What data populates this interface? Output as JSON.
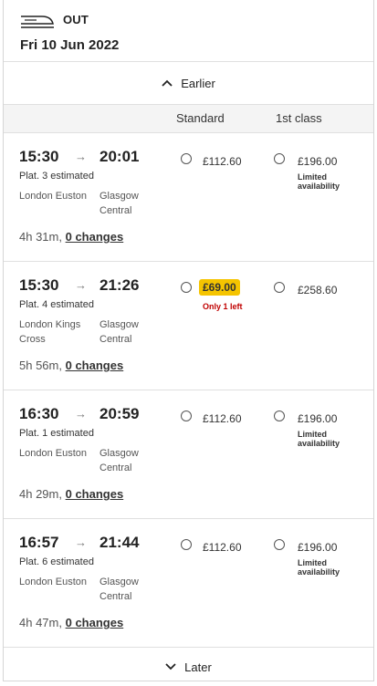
{
  "header": {
    "direction": "OUT",
    "date": "Fri 10 Jun 2022",
    "icon": "train-icon"
  },
  "earlier_label": "Earlier",
  "later_label": "Later",
  "columns": {
    "standard": "Standard",
    "first": "1st class"
  },
  "arrow_glyph": "→",
  "journeys": [
    {
      "dep": "15:30",
      "arr": "20:01",
      "platform": "Plat. 3 estimated",
      "from": "London Euston",
      "to": "Glasgow Central",
      "duration": "4h 31m,",
      "changes": "0 changes",
      "std_price": "£112.60",
      "std_note": "",
      "fst_price": "£196.00",
      "fst_note": "Limited availability"
    },
    {
      "dep": "15:30",
      "arr": "21:26",
      "platform": "Plat. 4 estimated",
      "from": "London Kings Cross",
      "to": "Glasgow Central",
      "duration": "5h 56m,",
      "changes": "0 changes",
      "std_price": "£69.00",
      "std_note": "Only 1 left",
      "fst_price": "£258.60",
      "fst_note": ""
    },
    {
      "dep": "16:30",
      "arr": "20:59",
      "platform": "Plat. 1 estimated",
      "from": "London Euston",
      "to": "Glasgow Central",
      "duration": "4h 29m,",
      "changes": "0 changes",
      "std_price": "£112.60",
      "std_note": "",
      "fst_price": "£196.00",
      "fst_note": "Limited availability"
    },
    {
      "dep": "16:57",
      "arr": "21:44",
      "platform": "Plat. 6 estimated",
      "from": "London Euston",
      "to": "Glasgow Central",
      "duration": "4h 47m,",
      "changes": "0 changes",
      "std_price": "£112.60",
      "std_note": "",
      "fst_price": "£196.00",
      "fst_note": "Limited availability"
    }
  ]
}
